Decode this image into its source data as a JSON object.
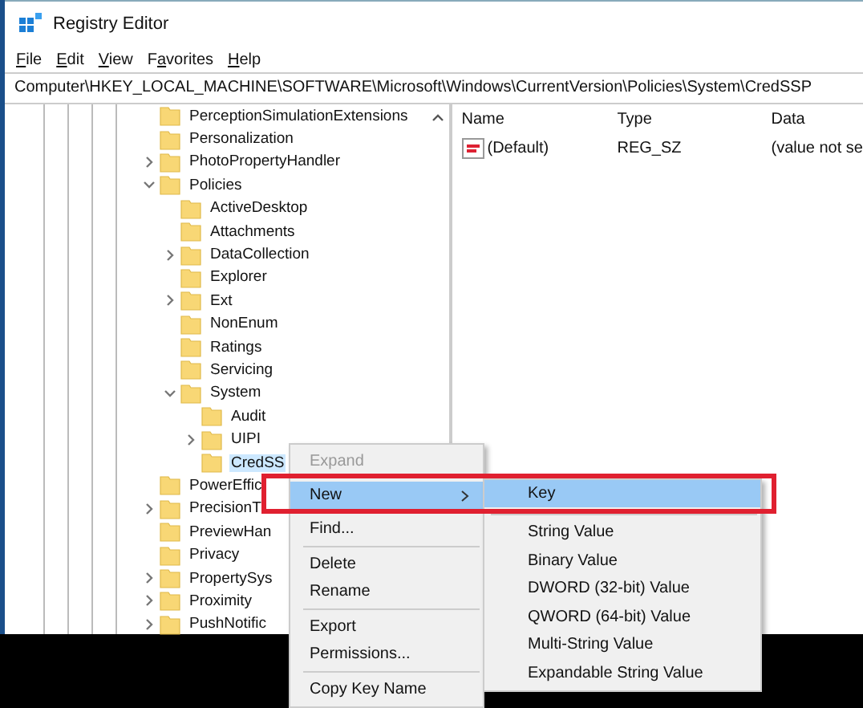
{
  "window": {
    "title": "Registry Editor"
  },
  "menu_bar": [
    {
      "label": "File"
    },
    {
      "label": "Edit"
    },
    {
      "label": "View"
    },
    {
      "label": "Favorites"
    },
    {
      "label": "Help"
    }
  ],
  "address": "Computer\\HKEY_LOCAL_MACHINE\\SOFTWARE\\Microsoft\\Windows\\CurrentVersion\\Policies\\System\\CredSSP",
  "tree": [
    {
      "label": "PerceptionSimulationExtensions",
      "selected": false
    },
    {
      "label": "Personalization",
      "selected": false
    },
    {
      "label": "PhotoPropertyHandler",
      "expanded": false,
      "selected": false
    },
    {
      "label": "Policies",
      "expanded": true,
      "selected": false,
      "children": [
        {
          "label": "ActiveDesktop",
          "selected": false
        },
        {
          "label": "Attachments",
          "selected": false
        },
        {
          "label": "DataCollection",
          "expanded": false,
          "selected": false
        },
        {
          "label": "Explorer",
          "selected": false
        },
        {
          "label": "Ext",
          "expanded": false,
          "selected": false
        },
        {
          "label": "NonEnum",
          "selected": false
        },
        {
          "label": "Ratings",
          "selected": false
        },
        {
          "label": "Servicing",
          "selected": false
        },
        {
          "label": "System",
          "expanded": true,
          "selected": false,
          "children": [
            {
              "label": "Audit",
              "selected": false
            },
            {
              "label": "UIPI",
              "expanded": false,
              "selected": false
            },
            {
              "label": "CredSS",
              "selected": true
            }
          ]
        }
      ]
    },
    {
      "label": "PowerEffic",
      "selected": false
    },
    {
      "label": "PrecisionT",
      "expanded": false,
      "selected": false
    },
    {
      "label": "PreviewHan",
      "selected": false
    },
    {
      "label": "Privacy",
      "selected": false
    },
    {
      "label": "PropertySys",
      "expanded": false,
      "selected": false
    },
    {
      "label": "Proximity",
      "expanded": false,
      "selected": false
    },
    {
      "label": "PushNotific",
      "expanded": false,
      "selected": false
    }
  ],
  "values": {
    "columns": [
      "Name",
      "Type",
      "Data"
    ],
    "rows": [
      {
        "name": "(Default)",
        "type": "REG_SZ",
        "data": "(value not se"
      }
    ]
  },
  "context_menu": [
    {
      "kind": "item",
      "label": "Expand",
      "disabled": true,
      "selected": false,
      "submenu": false
    },
    {
      "kind": "item",
      "label": "New",
      "disabled": false,
      "selected": true,
      "submenu": true
    },
    {
      "kind": "item",
      "label": "Find...",
      "disabled": false,
      "selected": false,
      "submenu": false
    },
    {
      "kind": "separator"
    },
    {
      "kind": "item",
      "label": "Delete",
      "disabled": false,
      "selected": false,
      "submenu": false
    },
    {
      "kind": "item",
      "label": "Rename",
      "disabled": false,
      "selected": false,
      "submenu": false
    },
    {
      "kind": "separator"
    },
    {
      "kind": "item",
      "label": "Export",
      "disabled": false,
      "selected": false,
      "submenu": false
    },
    {
      "kind": "item",
      "label": "Permissions...",
      "disabled": false,
      "selected": false,
      "submenu": false
    },
    {
      "kind": "separator"
    },
    {
      "kind": "item",
      "label": "Copy Key Name",
      "disabled": false,
      "selected": false,
      "submenu": false
    }
  ],
  "submenu": [
    {
      "kind": "item",
      "label": "Key",
      "selected": true
    },
    {
      "kind": "separator"
    },
    {
      "kind": "item",
      "label": "String Value",
      "selected": false
    },
    {
      "kind": "item",
      "label": "Binary Value",
      "selected": false
    },
    {
      "kind": "item",
      "label": "DWORD (32-bit) Value",
      "selected": false
    },
    {
      "kind": "item",
      "label": "QWORD (64-bit) Value",
      "selected": false
    },
    {
      "kind": "item",
      "label": "Multi-String Value",
      "selected": false
    },
    {
      "kind": "item",
      "label": "Expandable String Value",
      "selected": false
    }
  ]
}
